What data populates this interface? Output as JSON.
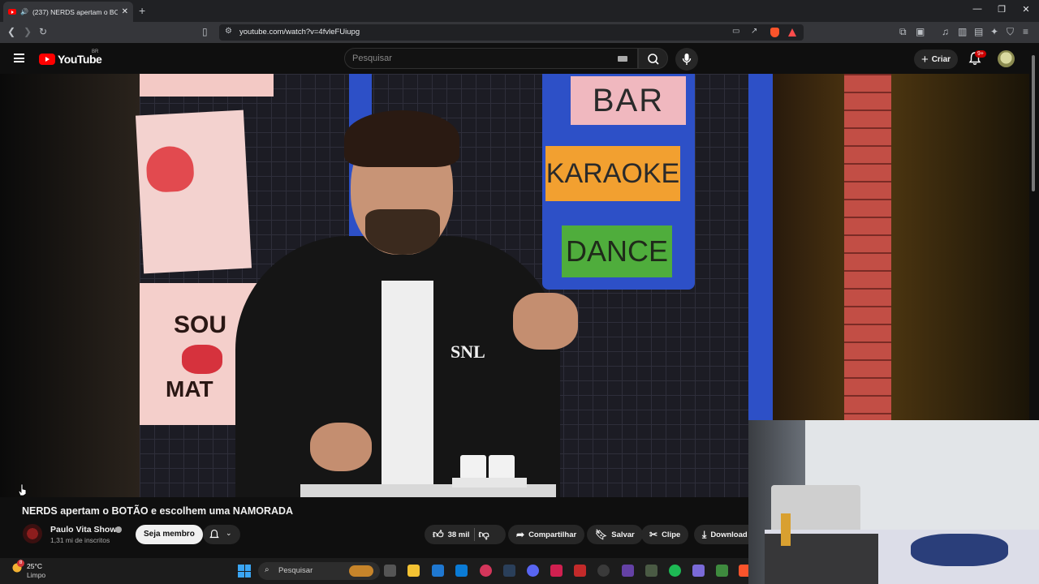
{
  "browser": {
    "tab_title": "(237) NERDS apertam o BOTÃ",
    "url": "youtube.com/watch?v=4fvleFUiupg"
  },
  "youtube": {
    "logo_text": "YouTube",
    "country_code": "BR",
    "search_placeholder": "Pesquisar",
    "create_label": "Criar",
    "notification_count": "9+"
  },
  "video": {
    "scene_labels": [
      "BAR",
      "KARAOKE",
      "DANCE"
    ],
    "poster_text": [
      "SOU",
      "MAT"
    ],
    "shirt_text": "SNL",
    "title": "NERDS apertam o BOTÃO e escolhem uma NAMORADA"
  },
  "channel": {
    "name": "Paulo Vita Show",
    "subscribers": "1,31 mi de inscritos",
    "join_label": "Seja membro"
  },
  "actions": {
    "likes": "38 mil",
    "share": "Compartilhar",
    "save": "Salvar",
    "clip": "Clipe",
    "download": "Download"
  },
  "taskbar": {
    "weather_badge": "8",
    "temperature": "25°C",
    "condition": "Limpo",
    "search_label": "Pesquisar"
  },
  "colors": {
    "youtube_red": "#ff0000",
    "background": "#0f0f0f",
    "chip": "#272727",
    "bar_sign": "#f0b8bf",
    "karaoke_sign": "#f2a030",
    "dance_sign": "#4fad3c",
    "blue_frame": "#2d50c7",
    "brick": "#e2625a"
  }
}
